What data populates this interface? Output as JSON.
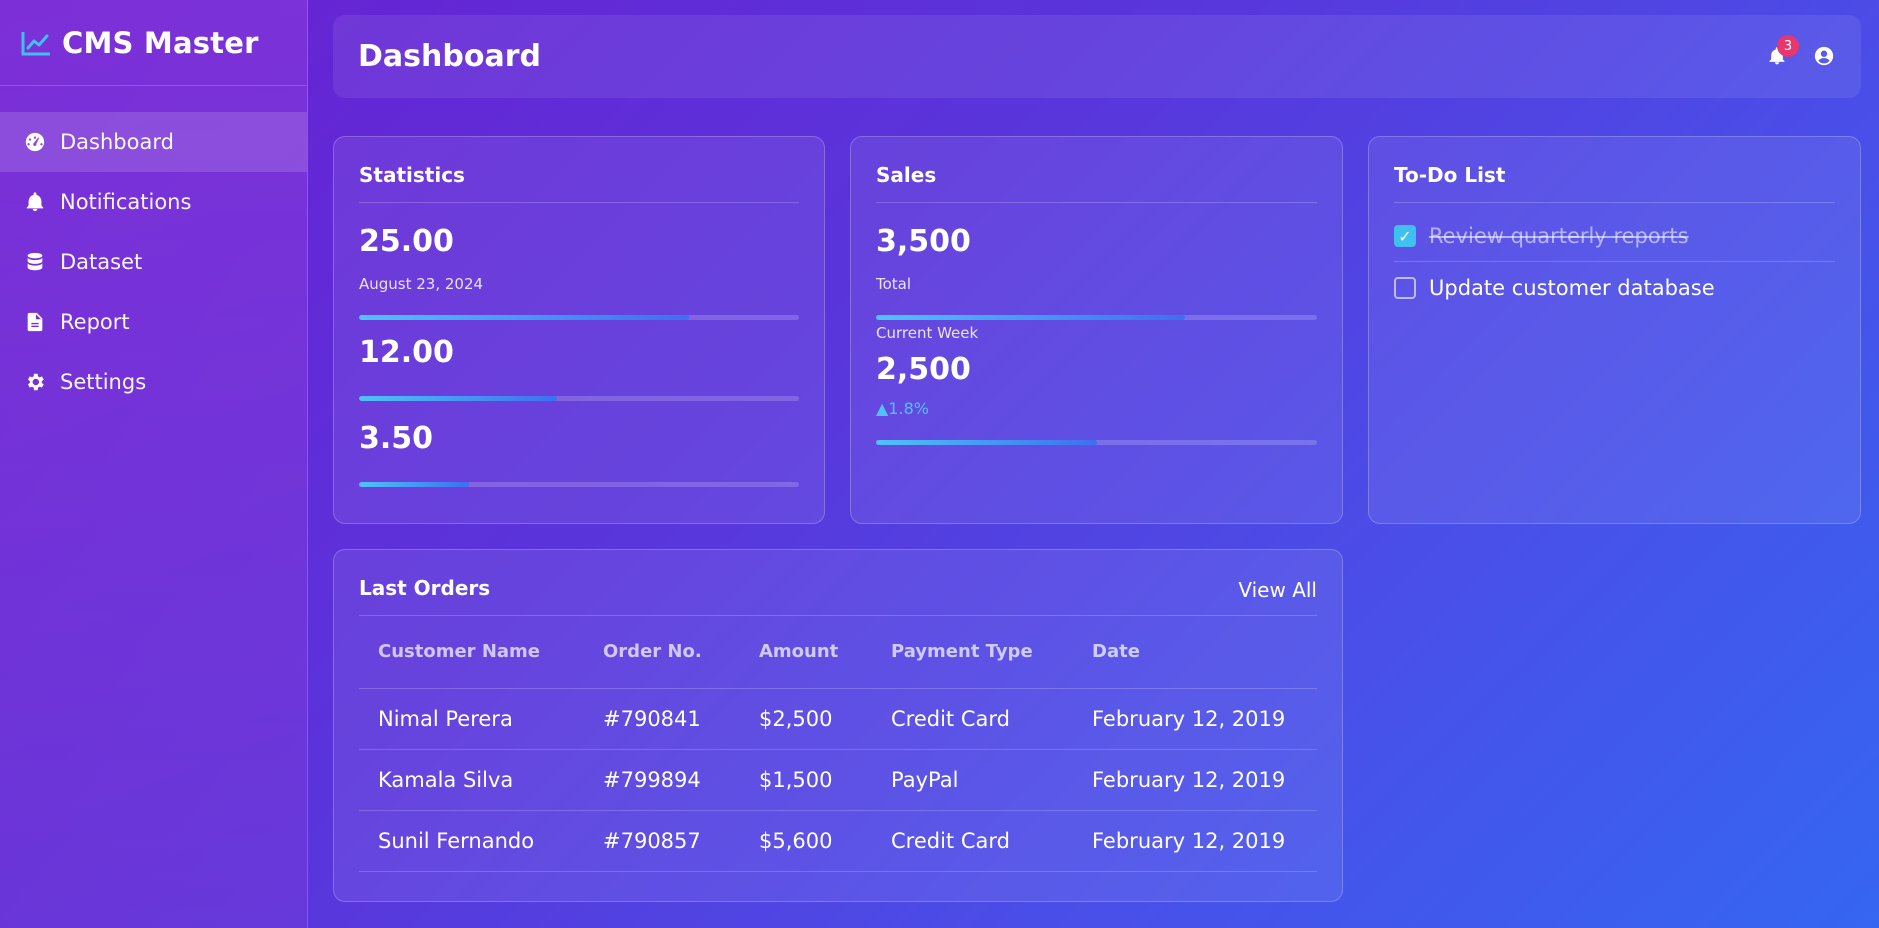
{
  "brand": {
    "name": "CMS Master",
    "accent": "#3fc1f0"
  },
  "sidebar": {
    "items": [
      {
        "label": "Dashboard",
        "icon": "gauge-icon",
        "active": true
      },
      {
        "label": "Notifications",
        "icon": "bell-icon"
      },
      {
        "label": "Dataset",
        "icon": "database-icon"
      },
      {
        "label": "Report",
        "icon": "file-icon"
      },
      {
        "label": "Settings",
        "icon": "gear-icon"
      }
    ]
  },
  "header": {
    "title": "Dashboard",
    "notification_count": "3"
  },
  "statistics": {
    "title": "Statistics",
    "items": [
      {
        "value": "25.00",
        "caption": "August 23, 2024",
        "progress": 0.75
      },
      {
        "value": "12.00",
        "progress": 0.45
      },
      {
        "value": "3.50",
        "progress": 0.25
      }
    ]
  },
  "sales": {
    "title": "Sales",
    "total_value": "3,500",
    "total_label": "Total",
    "total_progress": 0.7,
    "week_label": "Current Week",
    "week_value": "2,500",
    "change": "▲1.8%",
    "change_color": "#4fc3f7",
    "week_progress": 0.5
  },
  "todo": {
    "title": "To-Do List",
    "items": [
      {
        "label": "Review quarterly reports",
        "done": true
      },
      {
        "label": "Update customer database",
        "done": false
      }
    ]
  },
  "orders": {
    "title": "Last Orders",
    "view_all": "View All",
    "columns": [
      "Customer Name",
      "Order No.",
      "Amount",
      "Payment Type",
      "Date"
    ],
    "rows": [
      [
        "Nimal Perera",
        "#790841",
        "$2,500",
        "Credit Card",
        "February 12, 2019"
      ],
      [
        "Kamala Silva",
        "#799894",
        "$1,500",
        "PayPal",
        "February 12, 2019"
      ],
      [
        "Sunil Fernando",
        "#790857",
        "$5,600",
        "Credit Card",
        "February 12, 2019"
      ]
    ]
  }
}
